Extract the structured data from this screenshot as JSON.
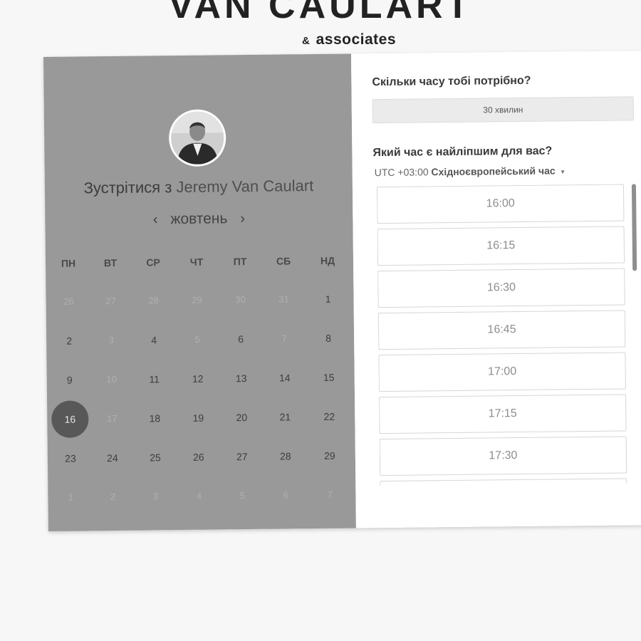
{
  "brand": {
    "title": "VAN CAULART",
    "amp": "&",
    "subtitle": "associates"
  },
  "host": {
    "prefix": "Зустрітися з",
    "name": "Jeremy Van Caulart"
  },
  "calendar": {
    "month": "жовтень",
    "prev_icon": "‹",
    "next_icon": "›",
    "weekdays": [
      "ПН",
      "ВТ",
      "СР",
      "ЧТ",
      "ПТ",
      "СБ",
      "НД"
    ],
    "weeks": [
      [
        {
          "d": "26",
          "muted": true
        },
        {
          "d": "27",
          "muted": true
        },
        {
          "d": "28",
          "muted": true
        },
        {
          "d": "29",
          "muted": true
        },
        {
          "d": "30",
          "muted": true
        },
        {
          "d": "31",
          "muted": true
        },
        {
          "d": "1"
        }
      ],
      [
        {
          "d": "2"
        },
        {
          "d": "3",
          "muted": true
        },
        {
          "d": "4"
        },
        {
          "d": "5",
          "muted": true
        },
        {
          "d": "6"
        },
        {
          "d": "7",
          "muted": true
        },
        {
          "d": "8"
        }
      ],
      [
        {
          "d": "9"
        },
        {
          "d": "10",
          "muted": true
        },
        {
          "d": "11"
        },
        {
          "d": "12"
        },
        {
          "d": "13"
        },
        {
          "d": "14"
        },
        {
          "d": "15"
        }
      ],
      [
        {
          "d": "16",
          "selected": true
        },
        {
          "d": "17",
          "muted": true
        },
        {
          "d": "18"
        },
        {
          "d": "19"
        },
        {
          "d": "20"
        },
        {
          "d": "21"
        },
        {
          "d": "22"
        }
      ],
      [
        {
          "d": "23"
        },
        {
          "d": "24"
        },
        {
          "d": "25"
        },
        {
          "d": "26"
        },
        {
          "d": "27"
        },
        {
          "d": "28"
        },
        {
          "d": "29"
        }
      ],
      [
        {
          "d": "1",
          "muted": true
        },
        {
          "d": "2",
          "muted": true
        },
        {
          "d": "3",
          "muted": true
        },
        {
          "d": "4",
          "muted": true
        },
        {
          "d": "5",
          "muted": true
        },
        {
          "d": "6",
          "muted": true
        },
        {
          "d": "7",
          "muted": true
        }
      ]
    ]
  },
  "booking": {
    "duration_question": "Скільки часу тобі потрібно?",
    "duration_value": "30 хвилин",
    "time_question": "Який час є найліпшим для вас?",
    "timezone_offset": "UTC +03:00",
    "timezone_name": "Східноєвропейський час",
    "timezone_caret": "▾",
    "slots": [
      "16:00",
      "16:15",
      "16:30",
      "16:45",
      "17:00",
      "17:15",
      "17:30",
      ""
    ]
  },
  "colors": {
    "left_panel": "#999999",
    "right_panel": "#ffffff",
    "selected_day": "#585858",
    "page_background": "#f7f7f7"
  }
}
